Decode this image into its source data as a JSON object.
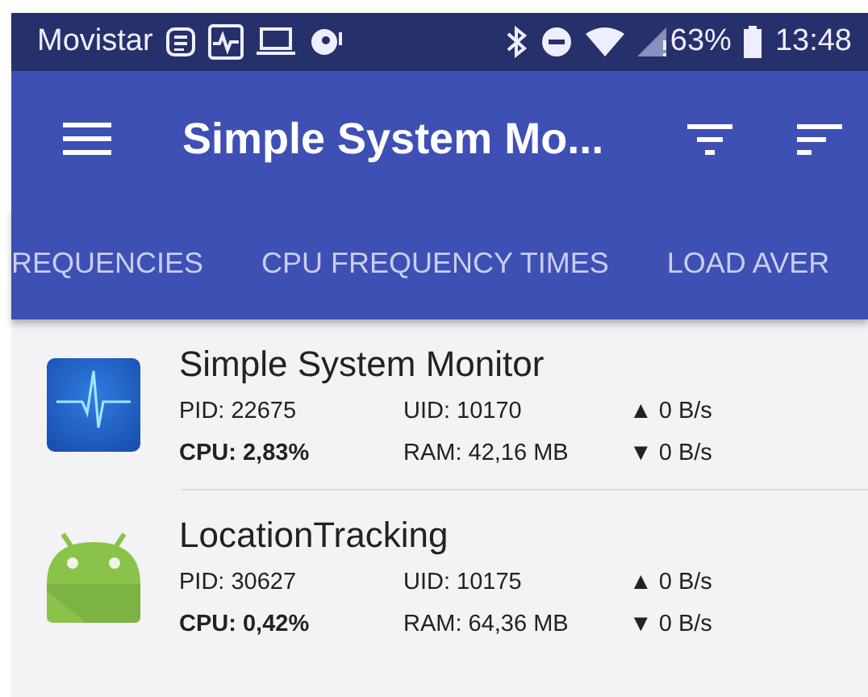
{
  "status_bar": {
    "carrier": "Movistar",
    "battery": "63%",
    "time": "13:48"
  },
  "app_bar": {
    "title": "Simple System Mo..."
  },
  "tabs": [
    {
      "label": "REQUENCIES",
      "selected": false
    },
    {
      "label": "CPU FREQUENCY TIMES",
      "selected": false
    },
    {
      "label": "LOAD AVER",
      "selected": false
    }
  ],
  "processes": [
    {
      "kind": "custom-icon",
      "name": "Simple System Monitor",
      "pid": "PID: 22675",
      "uid": "UID: 10170",
      "upload": "▲ 0 B/s",
      "cpu": "**CPU: 2,83%**",
      "ram": "RAM: 42,16 MB",
      "download": "▼ 0 B/s"
    },
    {
      "kind": "default-icon",
      "name": "LocationTracking",
      "pid": "PID: 30627",
      "uid": "UID: 10175",
      "upload": "▲ 0 B/s",
      "cpu": "**CPU: 0,42%**",
      "ram": "RAM: 64,36 MB",
      "download": "▼ 0 B/s"
    }
  ]
}
